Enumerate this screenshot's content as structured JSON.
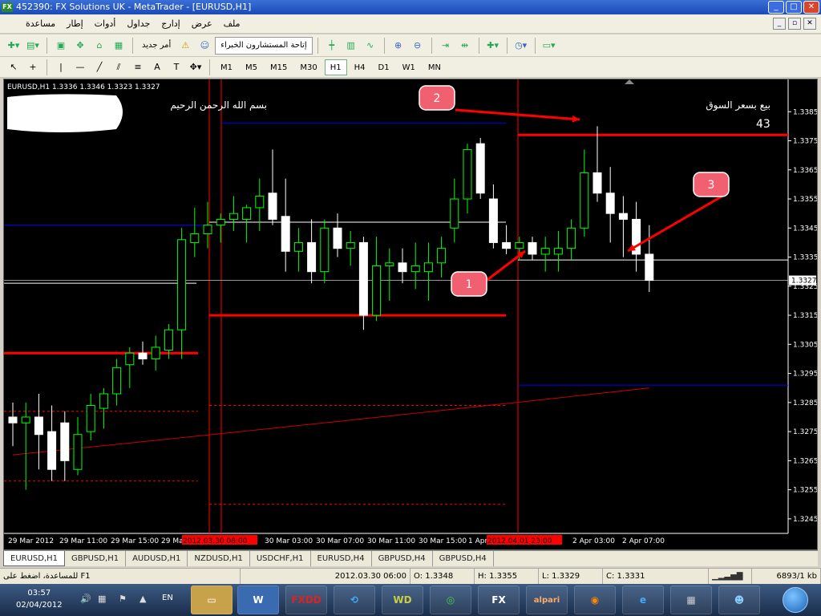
{
  "window": {
    "title": "452390: FX Solutions UK - MetaTrader - [EURUSD,H1]"
  },
  "menu": [
    "ملف",
    "عرض",
    "إدارج",
    "جداول",
    "أدوات",
    "إطار",
    "مساعدة"
  ],
  "toolbar1": {
    "new_order": "أمر جديد",
    "experts": "إتاحة المستشارون الخبراء"
  },
  "timeframes": [
    "M1",
    "M5",
    "M15",
    "M30",
    "H1",
    "H4",
    "D1",
    "W1",
    "MN"
  ],
  "active_timeframe": "H1",
  "chart": {
    "header": "EURUSD,H1  1.3336 1.3346 1.3323 1.3327",
    "basmala": "بسم الله الرحمن الرحيم",
    "market_sell": "بيع بسعر السوق",
    "pips": "43",
    "current_price": "1.3327",
    "markers": [
      "1",
      "2",
      "3"
    ],
    "colors": {
      "bull": "#00ff00",
      "bear": "#ffffff",
      "red": "#ff0000",
      "blue": "#0000ff",
      "ma": "#cc0000"
    }
  },
  "chart_data": {
    "type": "candlestick",
    "symbol": "EURUSD",
    "timeframe": "H1",
    "ylim": [
      1.324,
      1.3395
    ],
    "y_ticks": [
      "1.3385",
      "1.3375",
      "1.3365",
      "1.3355",
      "1.3345",
      "1.3335",
      "1.3325",
      "1.3315",
      "1.3305",
      "1.3295",
      "1.3285",
      "1.3275",
      "1.3265",
      "1.3255",
      "1.3245"
    ],
    "x_ticks": [
      "29 Mar 2012",
      "29 Mar 11:00",
      "29 Mar 15:00",
      "29 Ma",
      "2012.03.30 08:00",
      "30 Mar 03:00",
      "30 Mar 07:00",
      "30 Mar 11:00",
      "30 Mar 15:00",
      "1 Apr",
      "2012.04.01 23:00",
      "2 Apr 03:00",
      "2 Apr 07:00"
    ],
    "candles": [
      [
        1.328,
        1.3285,
        1.327,
        1.3278
      ],
      [
        1.3278,
        1.3285,
        1.3255,
        1.328
      ],
      [
        1.328,
        1.3288,
        1.3262,
        1.3274
      ],
      [
        1.3275,
        1.3284,
        1.3258,
        1.3262
      ],
      [
        1.3278,
        1.3282,
        1.3258,
        1.3265
      ],
      [
        1.3262,
        1.328,
        1.326,
        1.3274
      ],
      [
        1.3275,
        1.3288,
        1.3272,
        1.3284
      ],
      [
        1.3283,
        1.329,
        1.3276,
        1.3288
      ],
      [
        1.3288,
        1.33,
        1.3284,
        1.3297
      ],
      [
        1.3298,
        1.3304,
        1.329,
        1.3302
      ],
      [
        1.3302,
        1.3306,
        1.3298,
        1.33
      ],
      [
        1.33,
        1.3308,
        1.3296,
        1.3304
      ],
      [
        1.3303,
        1.3312,
        1.33,
        1.331
      ],
      [
        1.331,
        1.3345,
        1.33,
        1.3341
      ],
      [
        1.334,
        1.3352,
        1.3335,
        1.3343
      ],
      [
        1.3343,
        1.3354,
        1.3338,
        1.3346
      ],
      [
        1.3346,
        1.335,
        1.334,
        1.3348
      ],
      [
        1.3348,
        1.3356,
        1.3344,
        1.335
      ],
      [
        1.3348,
        1.3353,
        1.334,
        1.3352
      ],
      [
        1.3352,
        1.3362,
        1.3344,
        1.3356
      ],
      [
        1.3357,
        1.3372,
        1.3346,
        1.3348
      ],
      [
        1.3349,
        1.3362,
        1.333,
        1.3337
      ],
      [
        1.3337,
        1.3345,
        1.333,
        1.334
      ],
      [
        1.334,
        1.3348,
        1.3326,
        1.333
      ],
      [
        1.333,
        1.3348,
        1.3326,
        1.3345
      ],
      [
        1.3345,
        1.335,
        1.3335,
        1.3338
      ],
      [
        1.3338,
        1.3344,
        1.3332,
        1.334
      ],
      [
        1.334,
        1.3342,
        1.331,
        1.3315
      ],
      [
        1.3315,
        1.3342,
        1.3313,
        1.3332
      ],
      [
        1.3332,
        1.3338,
        1.332,
        1.3333
      ],
      [
        1.3333,
        1.3338,
        1.3326,
        1.333
      ],
      [
        1.333,
        1.334,
        1.3324,
        1.3332
      ],
      [
        1.333,
        1.334,
        1.332,
        1.3333
      ],
      [
        1.3333,
        1.3342,
        1.3328,
        1.3338
      ],
      [
        1.3345,
        1.3362,
        1.334,
        1.3355
      ],
      [
        1.3355,
        1.3374,
        1.335,
        1.3372
      ],
      [
        1.3374,
        1.3376,
        1.3355,
        1.3357
      ],
      [
        1.3355,
        1.336,
        1.3338,
        1.334
      ],
      [
        1.334,
        1.3346,
        1.3336,
        1.3338
      ],
      [
        1.3338,
        1.3342,
        1.3334,
        1.334
      ],
      [
        1.334,
        1.3342,
        1.3334,
        1.3336
      ],
      [
        1.3336,
        1.3342,
        1.333,
        1.3338
      ],
      [
        1.3336,
        1.3344,
        1.333,
        1.3338
      ],
      [
        1.3338,
        1.3348,
        1.3334,
        1.3345
      ],
      [
        1.3345,
        1.3372,
        1.3342,
        1.3364
      ],
      [
        1.3364,
        1.338,
        1.3354,
        1.3357
      ],
      [
        1.3357,
        1.3366,
        1.334,
        1.335
      ],
      [
        1.335,
        1.3356,
        1.3335,
        1.3348
      ],
      [
        1.3348,
        1.3354,
        1.333,
        1.3336
      ],
      [
        1.3336,
        1.3346,
        1.3323,
        1.3327
      ]
    ],
    "lines": {
      "red_levels": [
        1.3302,
        1.3315,
        1.3377
      ],
      "blue_levels": [
        1.3346,
        1.3381,
        1.3291
      ],
      "white_levels": [
        1.3326,
        1.3347,
        1.3334
      ]
    }
  },
  "tabs": [
    "EURUSD,H1",
    "GBPUSD,H1",
    "AUDUSD,H1",
    "NZDUSD,H1",
    "USDCHF,H1",
    "EURUSD,H4",
    "GBPUSD,H4",
    "GBPUSD,H4"
  ],
  "active_tab": "EURUSD,H1",
  "status": {
    "help": "للمساعدة، اضغط على F1",
    "time": "2012.03.30 06:00",
    "open": "O: 1.3348",
    "high": "H: 1.3355",
    "low": "L: 1.3329",
    "close": "C: 1.3331",
    "traffic": "6893/1 kb"
  },
  "taskbar": {
    "time": "03:57",
    "date": "02/04/2012",
    "lang": "EN",
    "apps": [
      "FXDD",
      "WD",
      "FX",
      "alpari"
    ]
  }
}
